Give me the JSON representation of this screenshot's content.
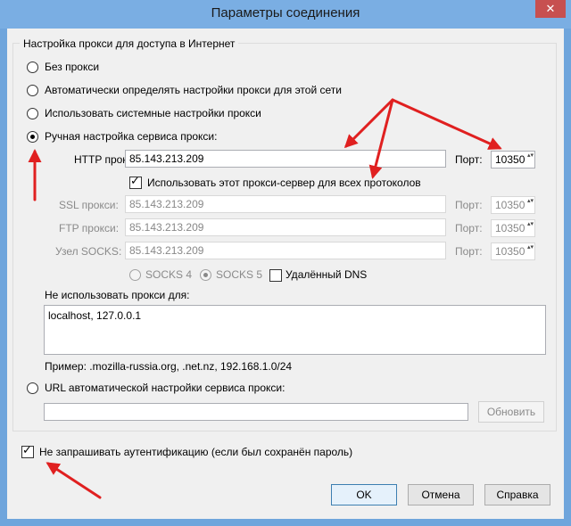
{
  "window": {
    "title": "Параметры соединения",
    "close_glyph": "✕"
  },
  "proxy_group": {
    "legend": "Настройка прокси для доступа в Интернет"
  },
  "options": {
    "no_proxy": "Без прокси",
    "auto_detect": "Автоматически определять настройки прокси для этой сети",
    "system": "Использовать системные настройки прокси",
    "manual": "Ручная настройка сервиса прокси:",
    "auto_url": "URL автоматической настройки сервиса прокси:"
  },
  "http": {
    "label": "HTTP прокси:",
    "value": "85.143.213.209",
    "port_label": "Порт:",
    "port": "10350"
  },
  "use_all": {
    "label": "Использовать этот прокси-сервер для всех протоколов",
    "checked": true
  },
  "ssl": {
    "label": "SSL прокси:",
    "value": "85.143.213.209",
    "port_label": "Порт:",
    "port": "10350"
  },
  "ftp": {
    "label": "FTP прокси:",
    "value": "85.143.213.209",
    "port_label": "Порт:",
    "port": "10350"
  },
  "socks": {
    "label": "Узел SOCKS:",
    "value": "85.143.213.209",
    "port_label": "Порт:",
    "port": "10350"
  },
  "socks_version": {
    "v4": "SOCKS 4",
    "v5": "SOCKS 5",
    "remote_dns": "Удалённый DNS"
  },
  "no_proxy_for": {
    "label": "Не использовать прокси для:",
    "value": "localhost, 127.0.0.1",
    "example": "Пример: .mozilla-russia.org, .net.nz, 192.168.1.0/24"
  },
  "auto_url": {
    "value": "",
    "reload_button": "Обновить"
  },
  "no_auth": {
    "label": "Не запрашивать аутентификацию (если был сохранён пароль)",
    "checked": true
  },
  "buttons": {
    "ok": "OK",
    "cancel": "Отмена",
    "help": "Справка"
  },
  "colors": {
    "annotation_arrow": "#e02020",
    "title_bar": "#7aaee3"
  }
}
